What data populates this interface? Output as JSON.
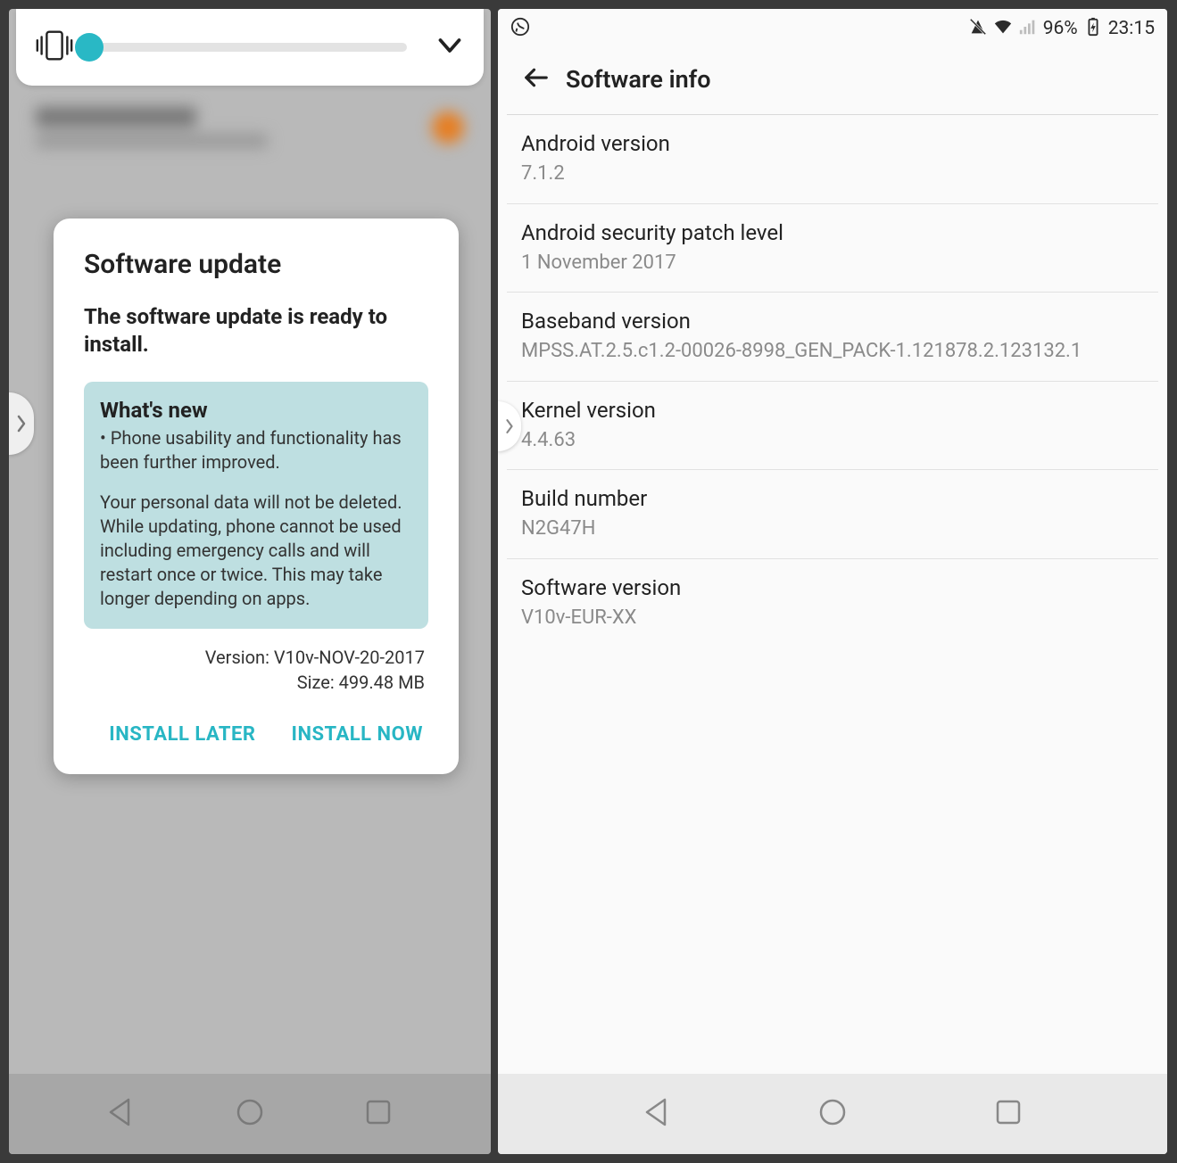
{
  "left": {
    "dialog": {
      "title": "Software update",
      "subtitle": "The software update is ready to install.",
      "whats_new_heading": "What's new",
      "bullet": "• Phone usability and functionality has been further improved.",
      "note": "Your personal data will not be deleted. While updating, phone cannot be used including emergency calls and will restart once or twice. This may take longer depending on apps.",
      "version_line": "Version: V10v-NOV-20-2017",
      "size_line": "Size: 499.48 MB",
      "install_later": "INSTALL LATER",
      "install_now": "INSTALL NOW"
    }
  },
  "right": {
    "status": {
      "battery_pct": "96%",
      "time": "23:15"
    },
    "header": "Software info",
    "rows": [
      {
        "title": "Android version",
        "value": "7.1.2"
      },
      {
        "title": "Android security patch level",
        "value": "1 November 2017"
      },
      {
        "title": "Baseband version",
        "value": "MPSS.AT.2.5.c1.2-00026-8998_GEN_PACK-1.121878.2.123132.1"
      },
      {
        "title": "Kernel version",
        "value": "4.4.63"
      },
      {
        "title": "Build number",
        "value": "N2G47H"
      },
      {
        "title": "Software version",
        "value": "V10v-EUR-XX"
      }
    ]
  }
}
